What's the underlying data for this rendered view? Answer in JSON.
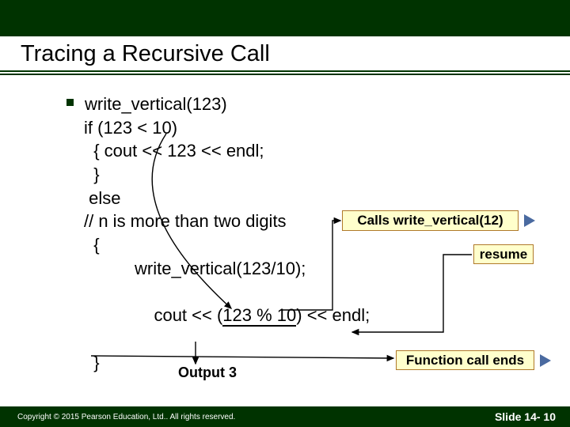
{
  "title": "Tracing a Recursive Call",
  "code": {
    "l1": "write_vertical(123)",
    "l2": "if (123 < 10)",
    "l3": "  { cout << 123 << endl;",
    "l4": "  }",
    "l5": " else",
    "l6": "// n is more than two digits",
    "l7": "  {",
    "l8": "write_vertical(123/10);",
    "l9a": "cout << (",
    "l9b": "123 % 10",
    "l9c": ") << endl;",
    "l10": "  }"
  },
  "labels": {
    "calls": "Calls write_vertical(12)",
    "resume": "resume",
    "ends": "Function call ends",
    "output": "Output 3"
  },
  "footer": {
    "copyright": "Copyright © 2015 Pearson Education, Ltd..  All rights reserved.",
    "slide": "Slide 14- 10"
  }
}
